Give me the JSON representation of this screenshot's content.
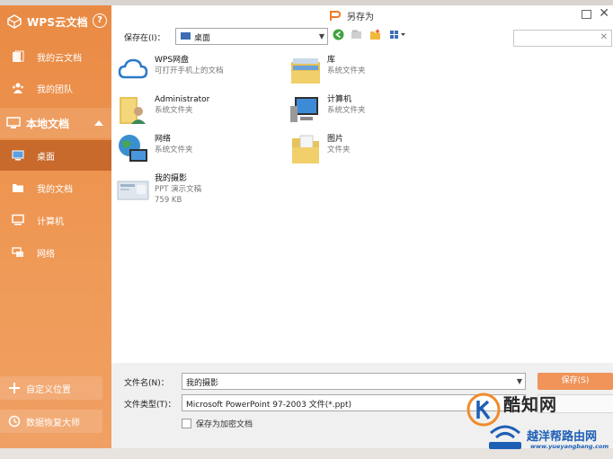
{
  "sidebar": {
    "title": "WPS云文档",
    "help": "?",
    "cloud_items": [
      {
        "label": "我的云文档",
        "icon": "cloud-doc-icon"
      },
      {
        "label": "我的团队",
        "icon": "team-icon"
      }
    ],
    "local_section": {
      "label": "本地文档",
      "icon": "monitor-icon"
    },
    "local_items": [
      {
        "label": "桌面",
        "icon": "desktop-icon",
        "active": true
      },
      {
        "label": "我的文档",
        "icon": "folder-icon"
      },
      {
        "label": "计算机",
        "icon": "computer-icon"
      },
      {
        "label": "网络",
        "icon": "network-icon"
      }
    ],
    "bottom_buttons": [
      {
        "label": "自定义位置",
        "icon": "plus-icon"
      },
      {
        "label": "数据恢复大师",
        "icon": "recovery-icon"
      }
    ]
  },
  "dialog": {
    "title": "另存为",
    "toolbar": {
      "save_in_label": "保存在(I)：",
      "save_in_value": "桌面"
    },
    "files": [
      {
        "name": "WPS网盘",
        "sub": "可打开手机上的文档",
        "icon": "cloud-drive-icon"
      },
      {
        "name": "库",
        "sub": "系统文件夹",
        "icon": "library-icon"
      },
      {
        "name": "Administrator",
        "sub": "系统文件夹",
        "icon": "user-folder-icon"
      },
      {
        "name": "计算机",
        "sub": "系统文件夹",
        "icon": "computer-icon"
      },
      {
        "name": "网络",
        "sub": "系统文件夹",
        "icon": "network-globe-icon"
      },
      {
        "name": "图片",
        "sub": "文件夹",
        "icon": "pictures-folder-icon"
      },
      {
        "name": "我的摄影",
        "sub": "PPT 演示文稿",
        "size": "759 KB",
        "icon": "ppt-file-icon"
      }
    ],
    "bottom": {
      "filename_label": "文件名(N)：",
      "filename_value": "我的摄影",
      "filetype_label": "文件类型(T)：",
      "filetype_value": "Microsoft PowerPoint 97-2003 文件(*.ppt)",
      "encrypt_label": "保存为加密文档",
      "save_button": "保存(S)"
    }
  },
  "watermark": {
    "title": "酷知网",
    "subtitle": "越洋帮路由网",
    "url": "www.yueyangbang.com"
  },
  "colors": {
    "sidebar_orange": "#ef9a57",
    "sidebar_active": "#c86a2b",
    "save_button": "#f0945a",
    "watermark_blue": "#1d5fb5"
  }
}
